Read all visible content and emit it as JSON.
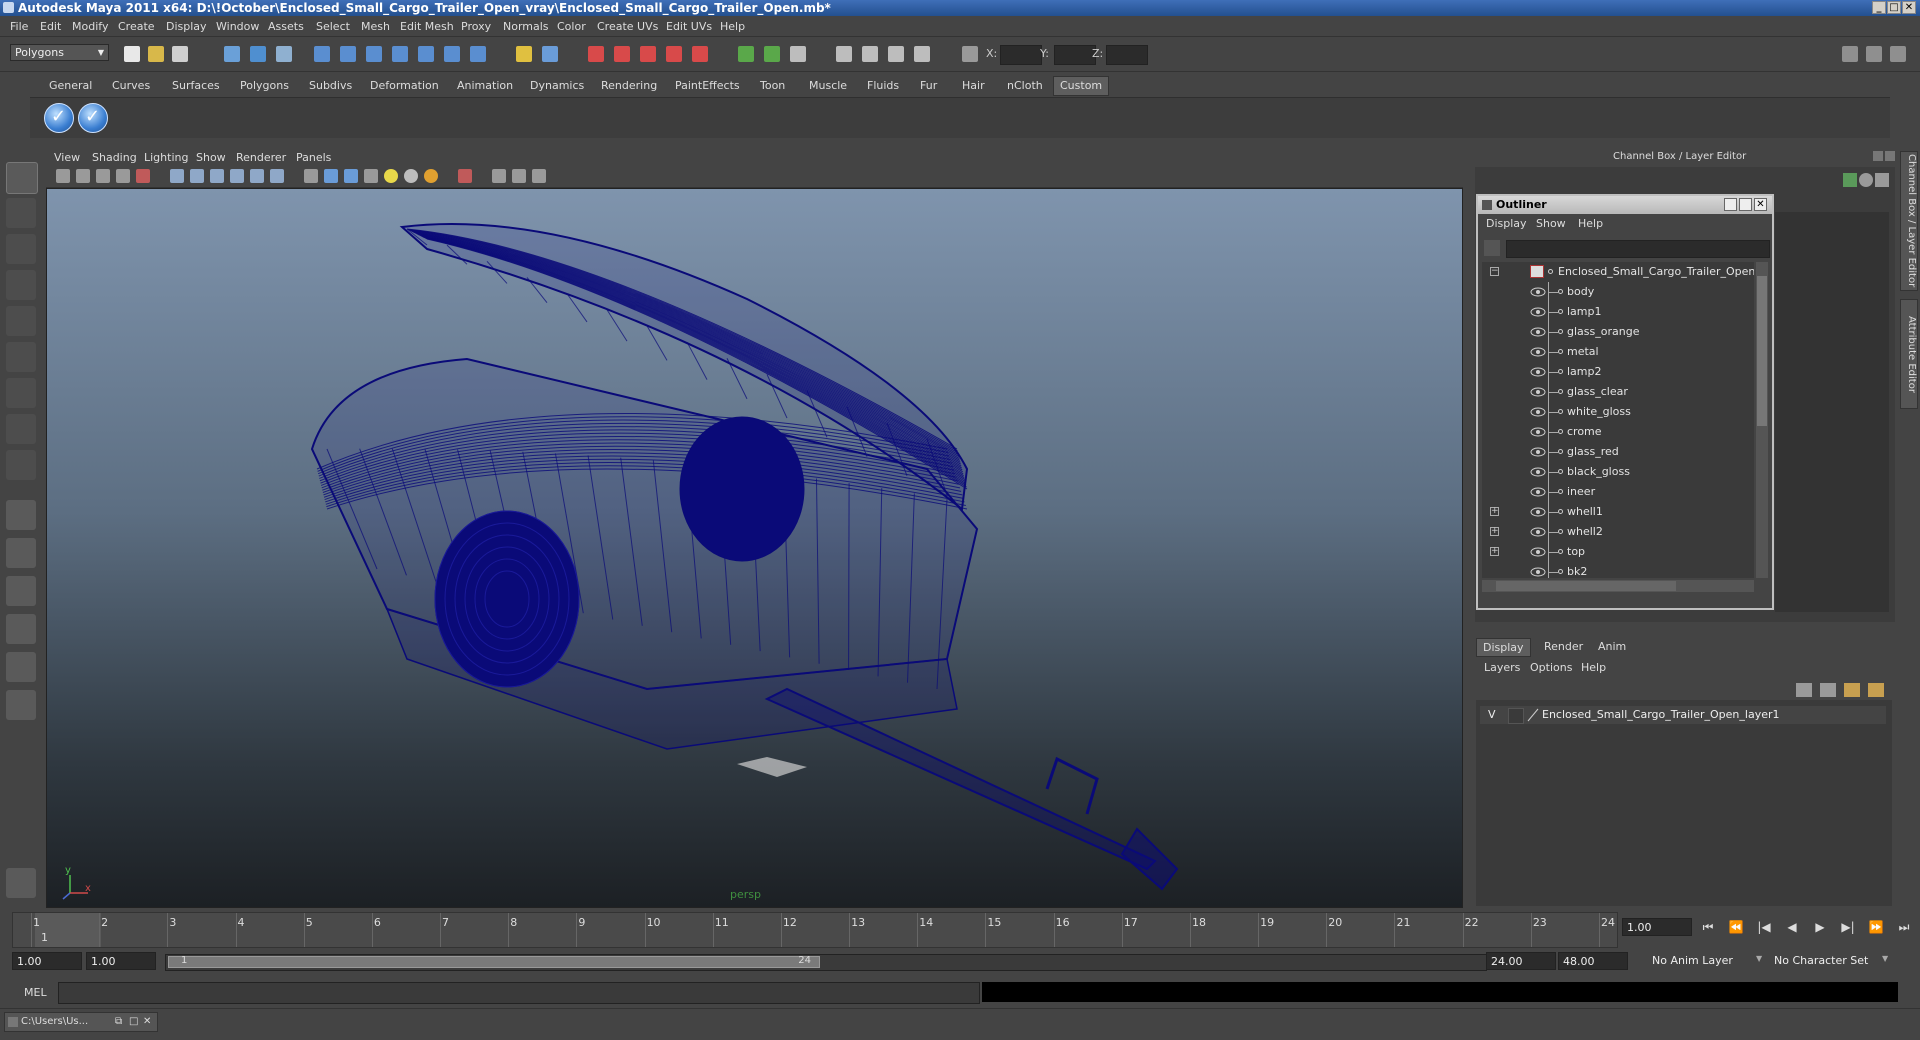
{
  "window": {
    "title": "Autodesk Maya 2011 x64: D:\\!October\\Enclosed_Small_Cargo_Trailer_Open_vray\\Enclosed_Small_Cargo_Trailer_Open.mb*",
    "controls": [
      "_",
      "□",
      "✕"
    ]
  },
  "menubar": [
    "File",
    "Edit",
    "Modify",
    "Create",
    "Display",
    "Window",
    "Assets",
    "Select",
    "Mesh",
    "Edit Mesh",
    "Proxy",
    "Normals",
    "Color",
    "Create UVs",
    "Edit UVs",
    "Help"
  ],
  "statusline": {
    "mode": "Polygons",
    "x_label": "X:",
    "y_label": "Y:",
    "z_label": "Z:"
  },
  "shelf": {
    "tabs": [
      "General",
      "Curves",
      "Surfaces",
      "Polygons",
      "Subdivs",
      "Deformation",
      "Animation",
      "Dynamics",
      "Rendering",
      "PaintEffects",
      "Toon",
      "Muscle",
      "Fluids",
      "Fur",
      "Hair",
      "nCloth",
      "Custom"
    ],
    "active_tab": "Custom"
  },
  "viewport": {
    "menu": [
      "View",
      "Shading",
      "Lighting",
      "Show",
      "Renderer",
      "Panels"
    ],
    "camera_label": "persp",
    "axis_x": "x",
    "axis_y": "y",
    "wire_color": "#0a0a78"
  },
  "channelbox": {
    "title": "Channel Box / Layer Editor",
    "side_tabs": [
      "Channel Box / Layer Editor",
      "Attribute Editor"
    ]
  },
  "outliner": {
    "title": "Outliner",
    "menu": [
      "Display",
      "Show",
      "Help"
    ],
    "root": "Enclosed_Small_Cargo_Trailer_Open",
    "items": [
      {
        "label": "body",
        "expandable": false
      },
      {
        "label": "lamp1",
        "expandable": false
      },
      {
        "label": "glass_orange",
        "expandable": false
      },
      {
        "label": "metal",
        "expandable": false
      },
      {
        "label": "lamp2",
        "expandable": false
      },
      {
        "label": "glass_clear",
        "expandable": false
      },
      {
        "label": "white_gloss",
        "expandable": false
      },
      {
        "label": "crome",
        "expandable": false
      },
      {
        "label": "glass_red",
        "expandable": false
      },
      {
        "label": "black_gloss",
        "expandable": false
      },
      {
        "label": "ineer",
        "expandable": false
      },
      {
        "label": "whell1",
        "expandable": true
      },
      {
        "label": "whell2",
        "expandable": true
      },
      {
        "label": "top",
        "expandable": true
      },
      {
        "label": "bk2",
        "expandable": false
      }
    ]
  },
  "layer_editor": {
    "tabs": [
      "Display",
      "Render",
      "Anim"
    ],
    "active_tab": "Display",
    "menu": [
      "Layers",
      "Options",
      "Help"
    ],
    "layers": [
      {
        "visible": "V",
        "name": "Enclosed_Small_Cargo_Trailer_Open_layer1"
      }
    ]
  },
  "timeline": {
    "ticks": [
      "1",
      "2",
      "3",
      "4",
      "5",
      "6",
      "7",
      "8",
      "9",
      "10",
      "11",
      "12",
      "13",
      "14",
      "15",
      "16",
      "17",
      "18",
      "19",
      "20",
      "21",
      "22",
      "23",
      "24"
    ],
    "current_frame": "1",
    "current_time": "1.00"
  },
  "range": {
    "start_time": "1.00",
    "playback_start": "1.00",
    "slider_start": "1",
    "slider_end": "24",
    "playback_end": "24.00",
    "end_time": "48.00",
    "anim_layer": "No Anim Layer",
    "character_set": "No Character Set"
  },
  "command": {
    "label": "MEL"
  },
  "taskbar": {
    "item": "C:\\Users\\Us..."
  }
}
